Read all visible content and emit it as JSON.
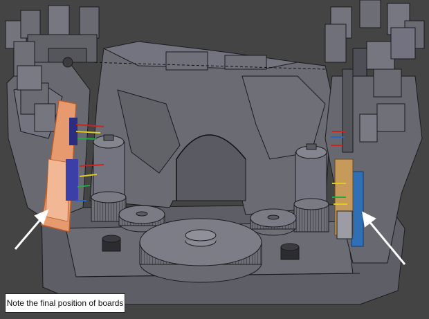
{
  "viewport": {
    "background": "#444444",
    "mesh_fill": "#6a6a72",
    "mesh_fill_light": "#7d7d85",
    "mesh_edge": "#1a1a1e",
    "left_board_color": "#e79a6e",
    "right_board_color": "#2f6fb5",
    "arrow_color": "#ffffff"
  },
  "caption": {
    "text": "Note the final position of boards"
  }
}
